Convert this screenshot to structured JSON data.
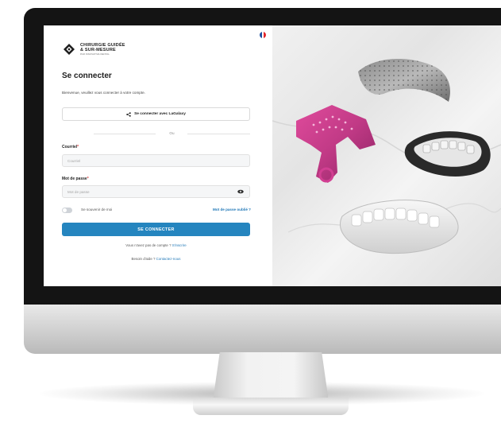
{
  "brand": {
    "line1": "CHIRURGIE GUIDÉE",
    "line2": "& SUR-MESURE",
    "line3": "PAR INNOVATIVE DENTAL"
  },
  "language": {
    "flag": "fr-flag",
    "colors": [
      "#1f4fa0",
      "#ffffff",
      "#e2262b"
    ]
  },
  "login": {
    "title": "Se connecter",
    "subtitle": "Bienvenue, veuillez vous connecter à votre compte.",
    "sso_label": "Se connecter avec LaGalaxy",
    "sso_icon": "share-icon",
    "divider": "Ou",
    "email_label": "Courriel",
    "email_required": "*",
    "email_placeholder": "Courriel",
    "email_value": "",
    "password_label": "Mot de passe",
    "password_required": "*",
    "password_placeholder": "Mot de passe",
    "password_value": "",
    "remember_label": "Se souvenir de moi",
    "remember_checked": false,
    "forgot_label": "Mot de passe oublié ?",
    "submit_label": "SE CONNECTER",
    "signup_text": "Vous n'avez pas de compte ?",
    "signup_link": "S'inscrire",
    "help_text": "Besoin d'aide ?",
    "help_link": "Contactez-nous"
  },
  "colors": {
    "accent": "#2585bf",
    "link": "#1f77b7",
    "required": "#e03b3b",
    "implant_guide": "#c13a86"
  }
}
